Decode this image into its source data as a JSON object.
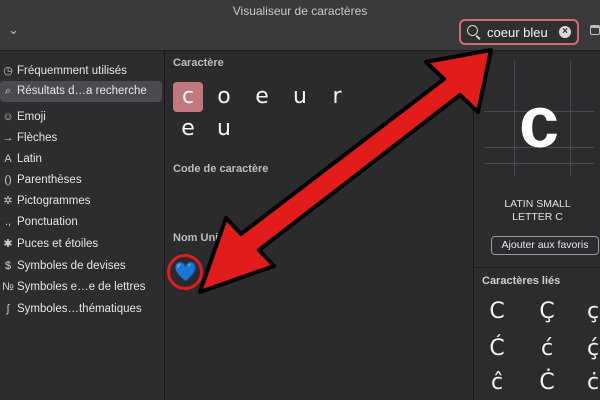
{
  "window": {
    "title": "Visualiseur de caractères"
  },
  "search": {
    "value": "coeur bleu"
  },
  "sidebar": {
    "items": [
      {
        "icon": "◷",
        "label": "Fréquemment utilisés"
      },
      {
        "icon": "⌕",
        "label": "Résultats d…a recherche"
      },
      {
        "icon": "☺",
        "label": "Emoji"
      },
      {
        "icon": "→",
        "label": "Flèches"
      },
      {
        "icon": "A",
        "label": "Latin"
      },
      {
        "icon": "()",
        "label": "Parenthèses"
      },
      {
        "icon": "✲",
        "label": "Pictogrammes"
      },
      {
        "icon": ".,",
        "label": "Ponctuation"
      },
      {
        "icon": "✱",
        "label": "Puces et étoiles"
      },
      {
        "icon": "$",
        "label": "Symboles de devises"
      },
      {
        "icon": "№",
        "label": "Symboles e…e de lettres"
      },
      {
        "icon": "∫",
        "label": "Symboles…thématiques"
      }
    ]
  },
  "main": {
    "character_heading": "Caractère",
    "characters": [
      "c",
      "o",
      "e",
      "u",
      "r",
      "e",
      "u"
    ],
    "code_heading": "Code de caractère",
    "unicode_heading": "Nom Uni",
    "emoji_results": [
      "💙",
      "🩵"
    ]
  },
  "detail": {
    "glyph": "c",
    "name_line1": "LATIN SMALL",
    "name_line2": "LETTER C",
    "favorite_button": "Ajouter aux favoris",
    "related_heading": "Caractères liés",
    "related": [
      "C",
      "Ç",
      "ç",
      "Ć",
      "ć",
      "ḉ",
      "ĉ",
      "Ċ",
      "ċ"
    ]
  },
  "colors": {
    "highlight": "#c2787f",
    "search_border": "#d46a78",
    "annotation_red": "#e21b1b"
  }
}
